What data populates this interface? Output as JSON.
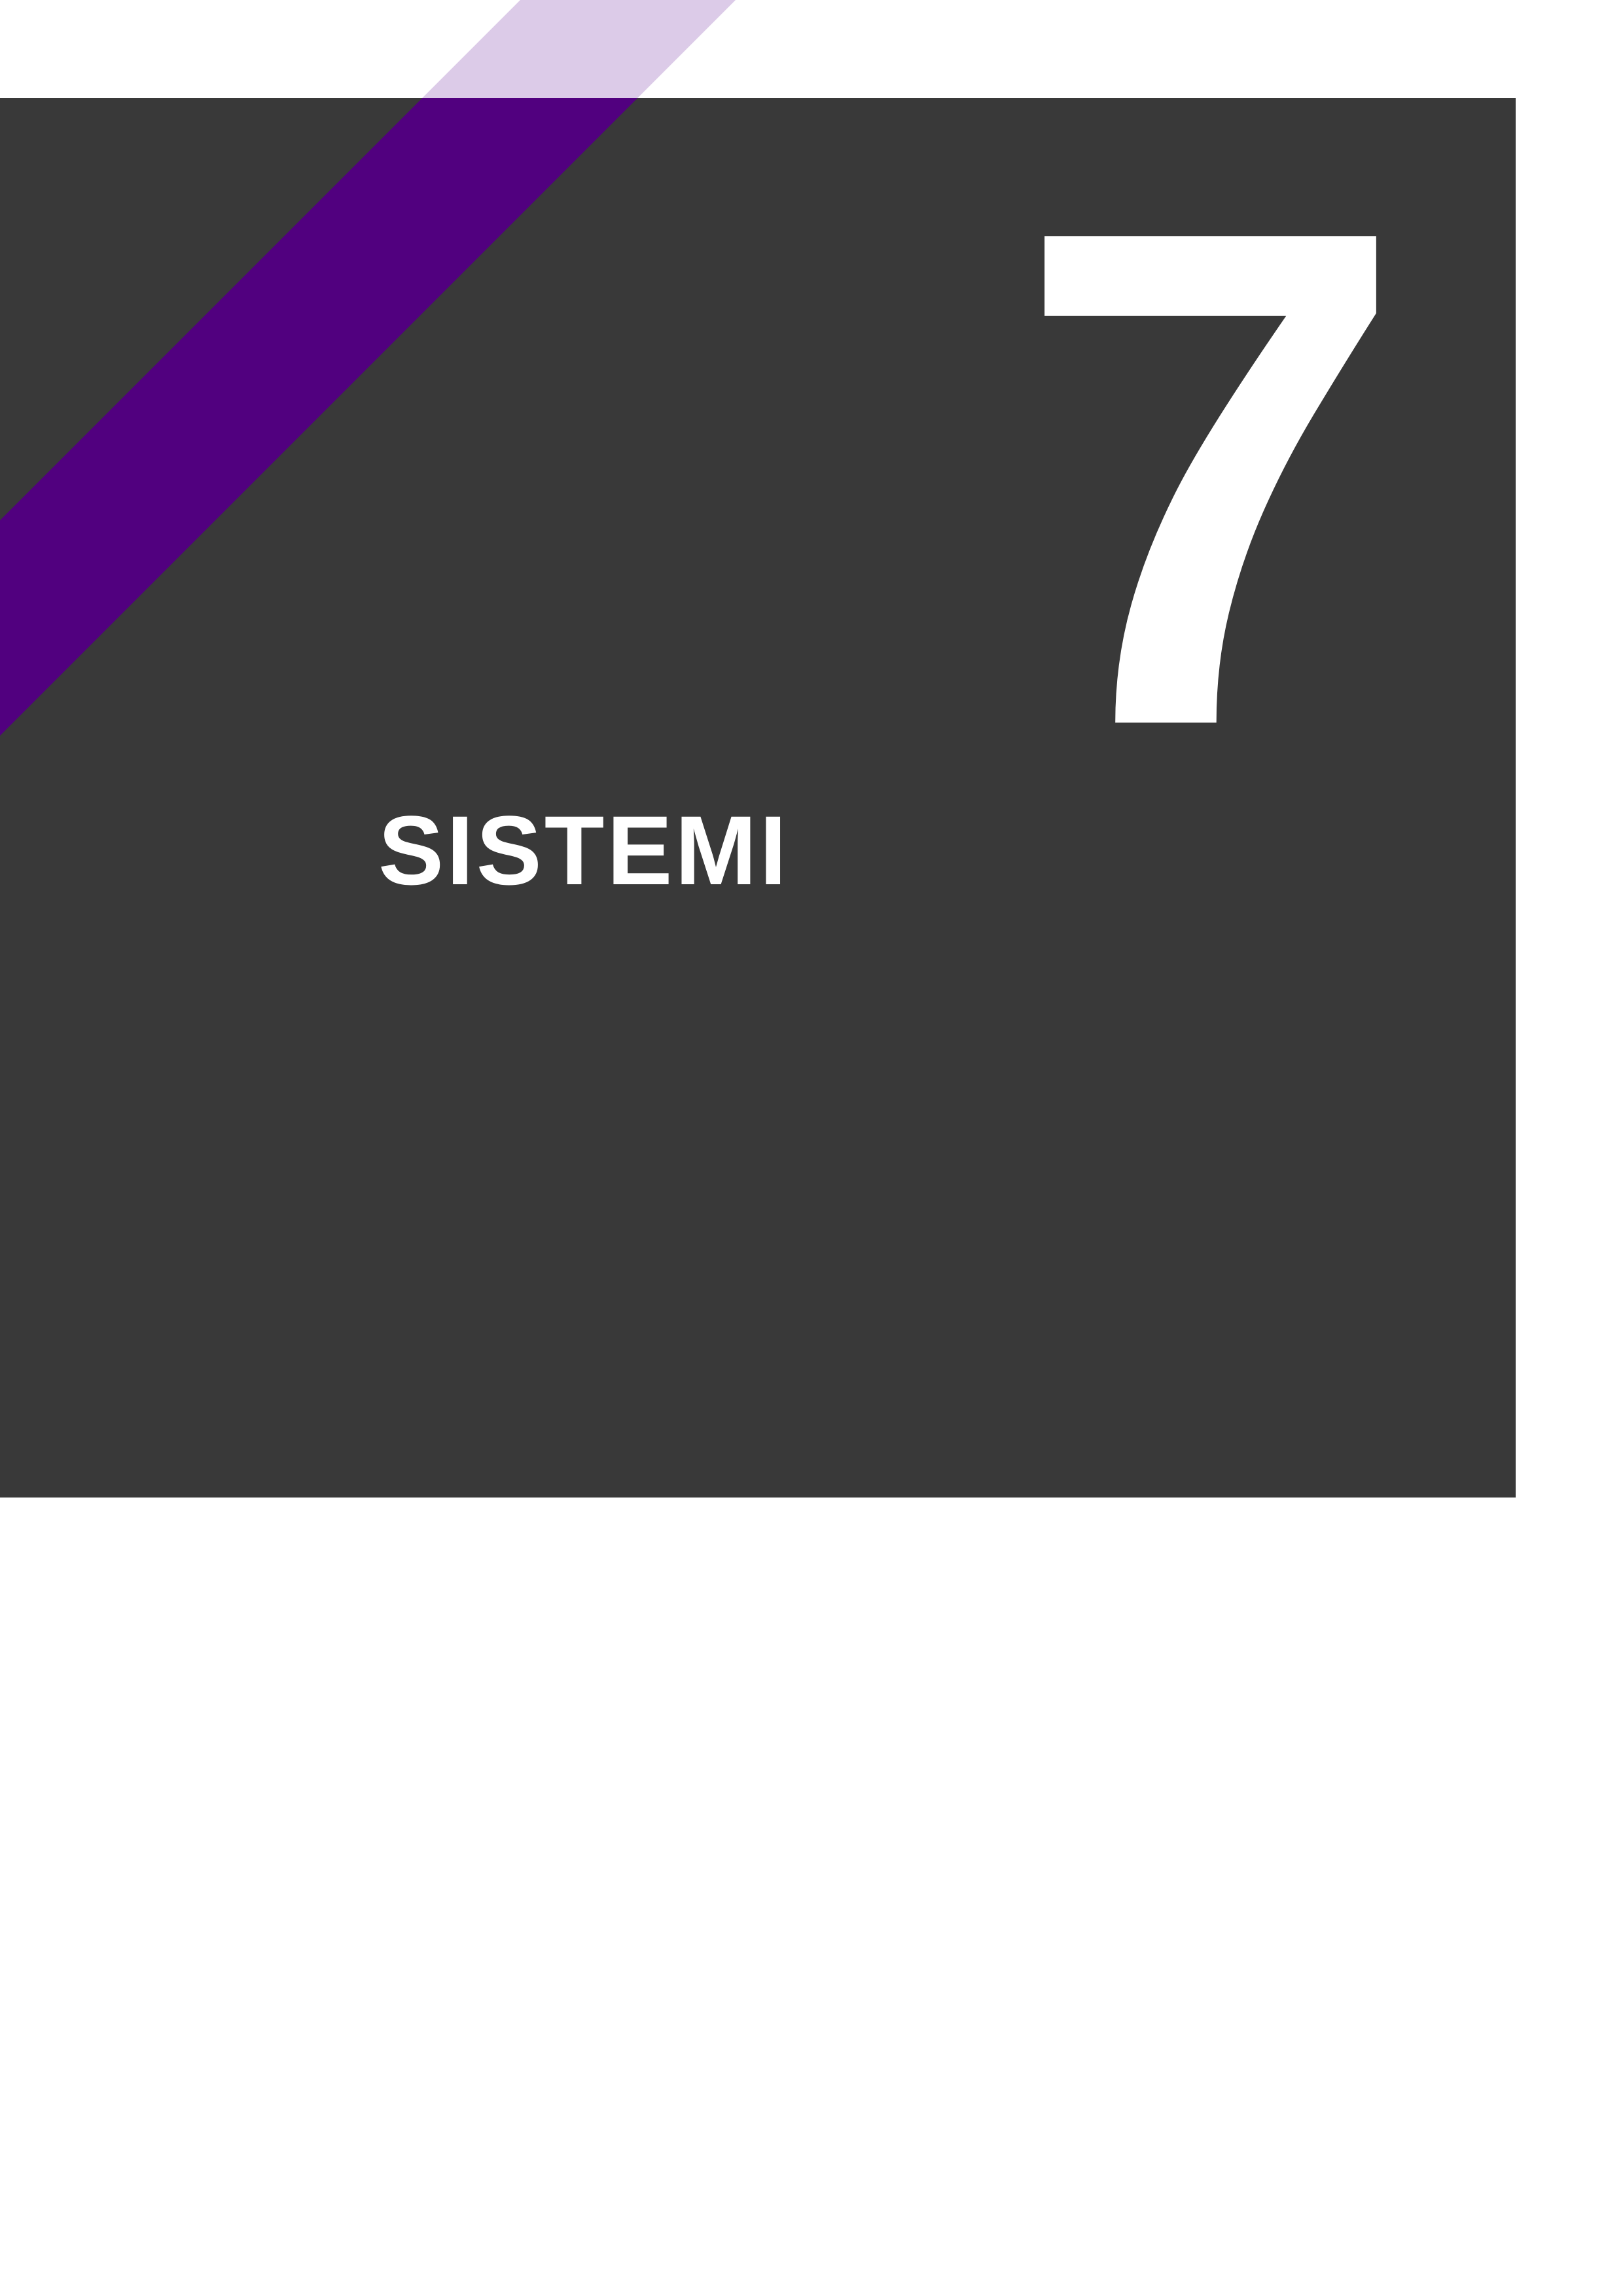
{
  "chapter": {
    "number": "7",
    "title": "SISTEMI"
  },
  "colors": {
    "page_background": "#ffffff",
    "panel_background": "#393939",
    "stripe_dark": "#51007f",
    "stripe_light": "#dccbe8",
    "text": "#ffffff"
  }
}
